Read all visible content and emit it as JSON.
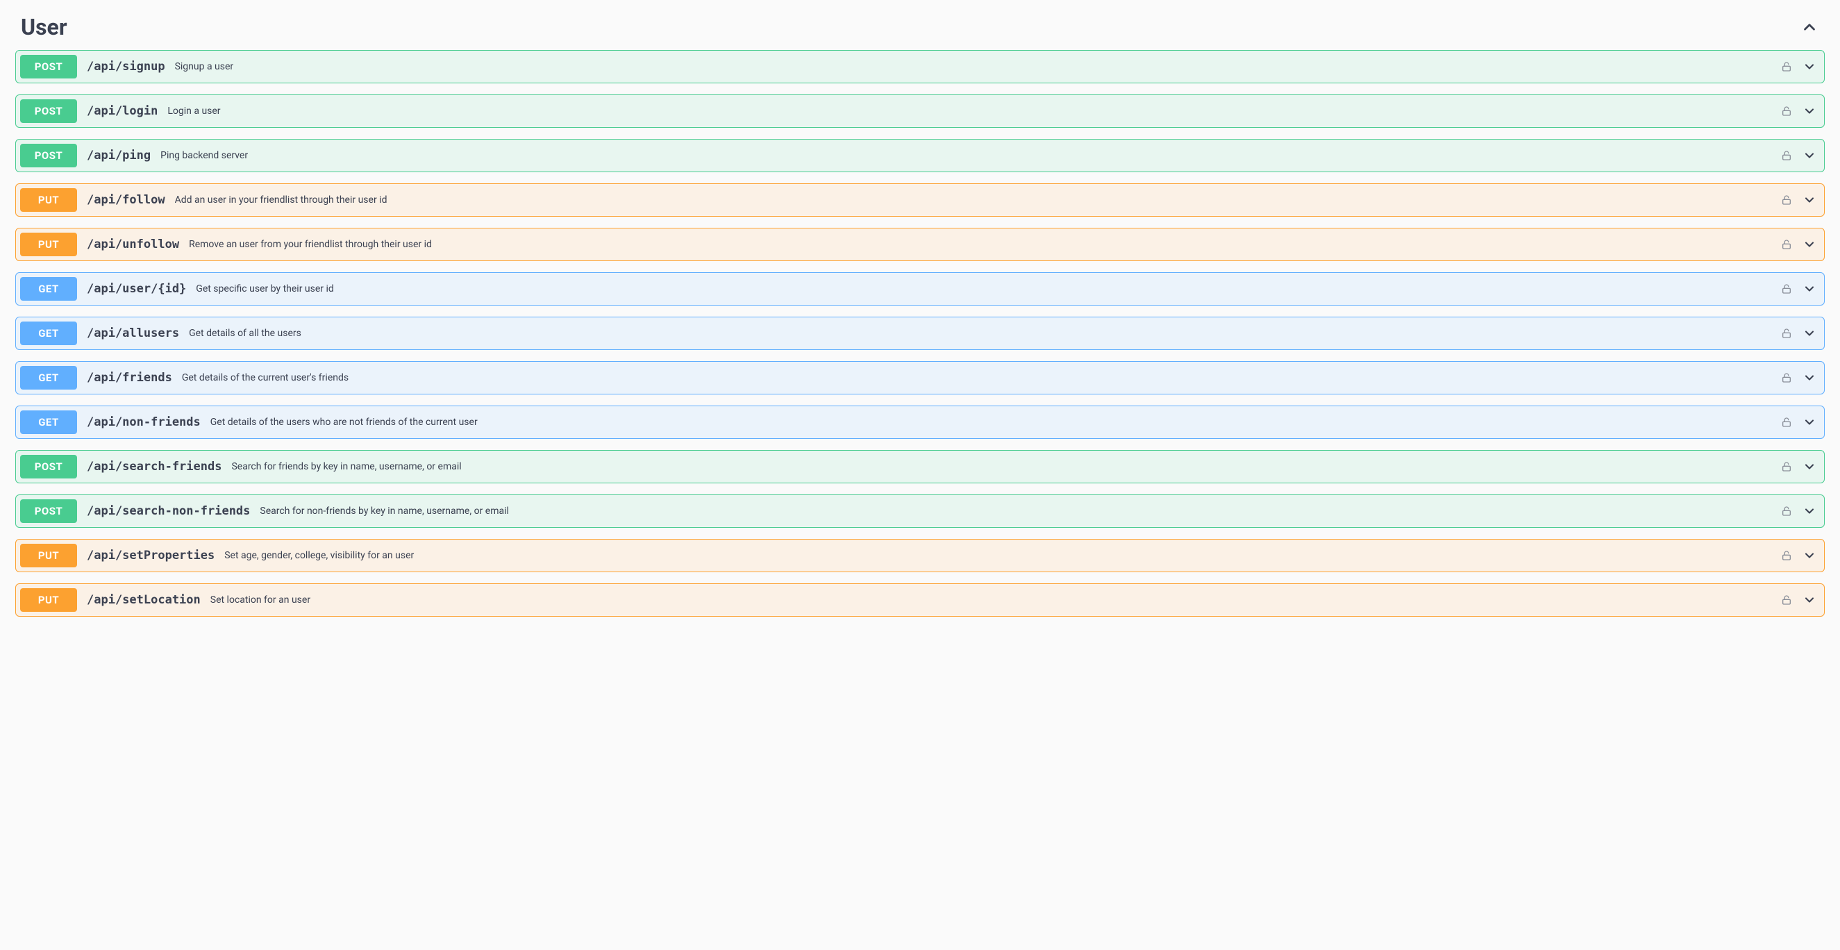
{
  "tag": {
    "name": "User"
  },
  "operations": [
    {
      "method": "POST",
      "path": "/api/signup",
      "summary": "Signup a user"
    },
    {
      "method": "POST",
      "path": "/api/login",
      "summary": "Login a user"
    },
    {
      "method": "POST",
      "path": "/api/ping",
      "summary": "Ping backend server"
    },
    {
      "method": "PUT",
      "path": "/api/follow",
      "summary": "Add an user in your friendlist through their user id"
    },
    {
      "method": "PUT",
      "path": "/api/unfollow",
      "summary": "Remove an user from your friendlist through their user id"
    },
    {
      "method": "GET",
      "path": "/api/user/{id}",
      "summary": "Get specific user by their user id"
    },
    {
      "method": "GET",
      "path": "/api/allusers",
      "summary": "Get details of all the users"
    },
    {
      "method": "GET",
      "path": "/api/friends",
      "summary": "Get details of the current user's friends"
    },
    {
      "method": "GET",
      "path": "/api/non-friends",
      "summary": "Get details of the users who are not friends of the current user"
    },
    {
      "method": "POST",
      "path": "/api/search-friends",
      "summary": "Search for friends by key in name, username, or email"
    },
    {
      "method": "POST",
      "path": "/api/search-non-friends",
      "summary": "Search for non-friends by key in name, username, or email"
    },
    {
      "method": "PUT",
      "path": "/api/setProperties",
      "summary": "Set age, gender, college, visibility for an user"
    },
    {
      "method": "PUT",
      "path": "/api/setLocation",
      "summary": "Set location for an user"
    }
  ]
}
